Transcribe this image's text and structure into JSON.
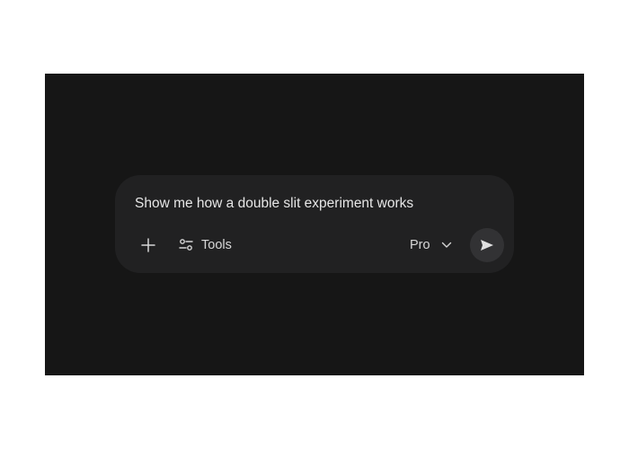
{
  "prompt": {
    "text": "Show me how a double slit experiment works"
  },
  "toolbar": {
    "add_icon": "plus-icon",
    "tools_icon": "sliders-icon",
    "tools_label": "Tools",
    "model_label": "Pro",
    "model_icon": "chevron-down-icon",
    "send_icon": "send-icon"
  },
  "colors": {
    "background": "#161616",
    "card": "#212122",
    "text": "#e7e7e7",
    "send_button": "#323234"
  }
}
